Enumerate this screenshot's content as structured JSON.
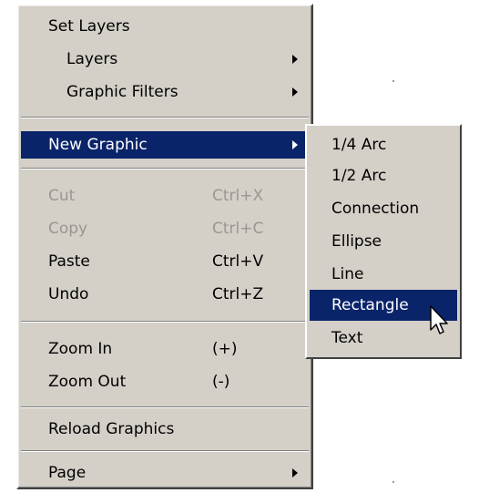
{
  "menu": {
    "set_layers": "Set Layers",
    "layers": "Layers",
    "graphic_filters": "Graphic Filters",
    "new_graphic": "New Graphic",
    "cut": "Cut",
    "cut_shortcut": "Ctrl+X",
    "copy": "Copy",
    "copy_shortcut": "Ctrl+C",
    "paste": "Paste",
    "paste_shortcut": "Ctrl+V",
    "undo": "Undo",
    "undo_shortcut": "Ctrl+Z",
    "zoom_in": "Zoom In",
    "zoom_in_shortcut": "(+)",
    "zoom_out": "Zoom Out",
    "zoom_out_shortcut": "(-)",
    "reload_graphics": "Reload Graphics",
    "page": "Page"
  },
  "submenu": {
    "items": [
      "1/4 Arc",
      "1/2 Arc",
      "Connection",
      "Ellipse",
      "Line",
      "Rectangle",
      "Text"
    ],
    "selected": "Rectangle"
  },
  "colors": {
    "menu_face": "#d4d0c8",
    "highlight": "#0a246a",
    "disabled_text": "#9a9790"
  }
}
